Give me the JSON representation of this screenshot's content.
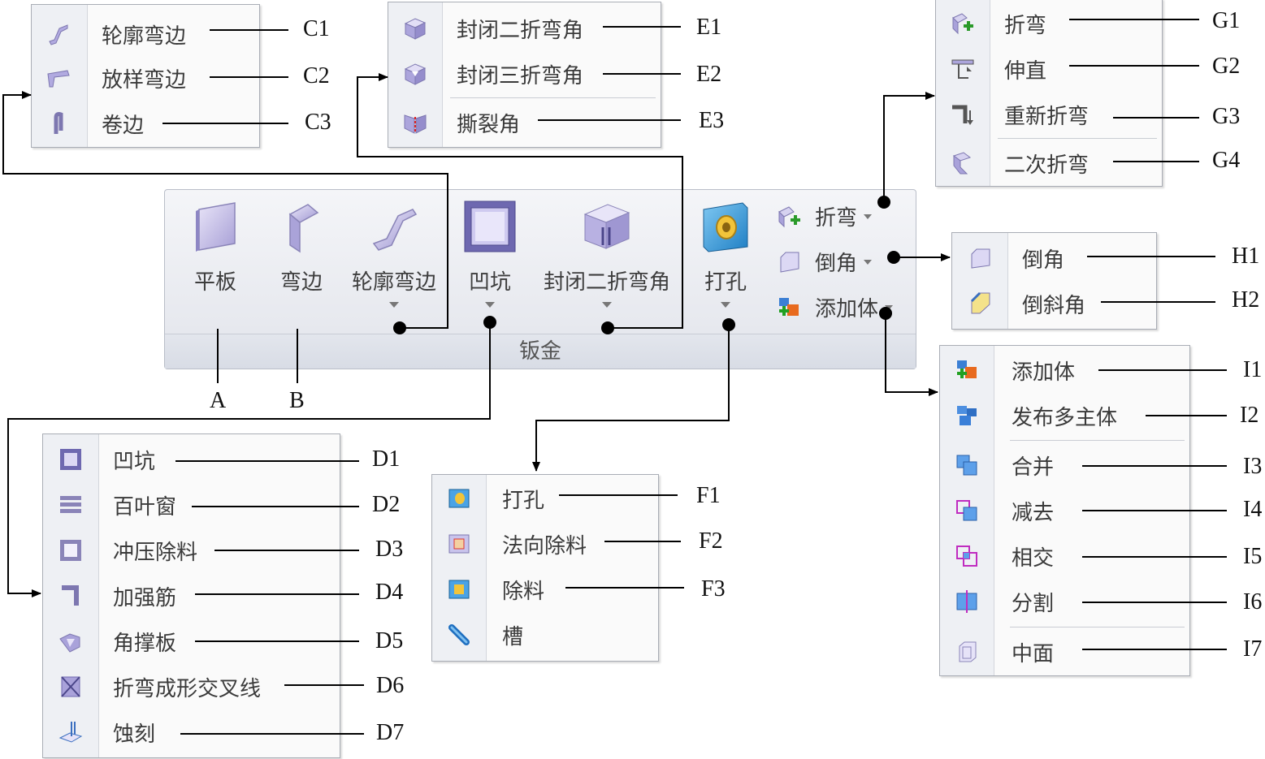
{
  "ribbon": {
    "group_label": "钣金",
    "buttons": [
      {
        "label": "平板",
        "code": "A"
      },
      {
        "label": "弯边",
        "code": "B"
      },
      {
        "label": "轮廓弯边"
      },
      {
        "label": "凹坑"
      },
      {
        "label": "封闭二折弯角"
      },
      {
        "label": "打孔"
      }
    ],
    "small_buttons": [
      {
        "label": "折弯"
      },
      {
        "label": "倒角"
      },
      {
        "label": "添加体"
      }
    ]
  },
  "menus": {
    "C": [
      {
        "label": "轮廓弯边",
        "code": "C1",
        "icon": "contour-flange-icon"
      },
      {
        "label": "放样弯边",
        "code": "C2",
        "icon": "lofted-flange-icon"
      },
      {
        "label": "卷边",
        "code": "C3",
        "icon": "hem-icon"
      }
    ],
    "E": [
      {
        "label": "封闭二折弯角",
        "code": "E1",
        "icon": "close-2-bend-corner-icon"
      },
      {
        "label": "封闭三折弯角",
        "code": "E2",
        "icon": "close-3-bend-corner-icon"
      },
      {
        "label": "撕裂角",
        "code": "E3",
        "icon": "break-corner-icon"
      }
    ],
    "G": [
      {
        "label": "折弯",
        "code": "G1",
        "icon": "bend-icon"
      },
      {
        "label": "伸直",
        "code": "G2",
        "icon": "unbend-icon"
      },
      {
        "label": "重新折弯",
        "code": "G3",
        "icon": "rebend-icon"
      },
      {
        "label": "二次折弯",
        "code": "G4",
        "icon": "jog-icon"
      }
    ],
    "H": [
      {
        "label": "倒角",
        "code": "H1",
        "icon": "chamfer-icon"
      },
      {
        "label": "倒斜角",
        "code": "H2",
        "icon": "bevel-icon"
      }
    ],
    "I": [
      {
        "label": "添加体",
        "code": "I1",
        "icon": "add-body-icon"
      },
      {
        "label": "发布多主体",
        "code": "I2",
        "icon": "publish-multibody-icon"
      },
      {
        "label": "合并",
        "code": "I3",
        "icon": "union-icon"
      },
      {
        "label": "减去",
        "code": "I4",
        "icon": "subtract-icon"
      },
      {
        "label": "相交",
        "code": "I5",
        "icon": "intersect-icon"
      },
      {
        "label": "分割",
        "code": "I6",
        "icon": "split-icon"
      },
      {
        "label": "中面",
        "code": "I7",
        "icon": "midsurface-icon"
      }
    ],
    "D": [
      {
        "label": "凹坑",
        "code": "D1",
        "icon": "dimple-icon"
      },
      {
        "label": "百叶窗",
        "code": "D2",
        "icon": "louver-icon"
      },
      {
        "label": "冲压除料",
        "code": "D3",
        "icon": "drawn-cutout-icon"
      },
      {
        "label": "加强筋",
        "code": "D4",
        "icon": "bead-icon"
      },
      {
        "label": "角撑板",
        "code": "D5",
        "icon": "gusset-icon"
      },
      {
        "label": "折弯成形交叉线",
        "code": "D6",
        "icon": "cross-brake-icon"
      },
      {
        "label": "蚀刻",
        "code": "D7",
        "icon": "etch-icon"
      }
    ],
    "F": [
      {
        "label": "打孔",
        "code": "F1",
        "icon": "hole-icon"
      },
      {
        "label": "法向除料",
        "code": "F2",
        "icon": "normal-cutout-icon"
      },
      {
        "label": "除料",
        "code": "F3",
        "icon": "cutout-icon"
      },
      {
        "label": "槽",
        "code": "",
        "icon": "slot-icon"
      }
    ]
  }
}
